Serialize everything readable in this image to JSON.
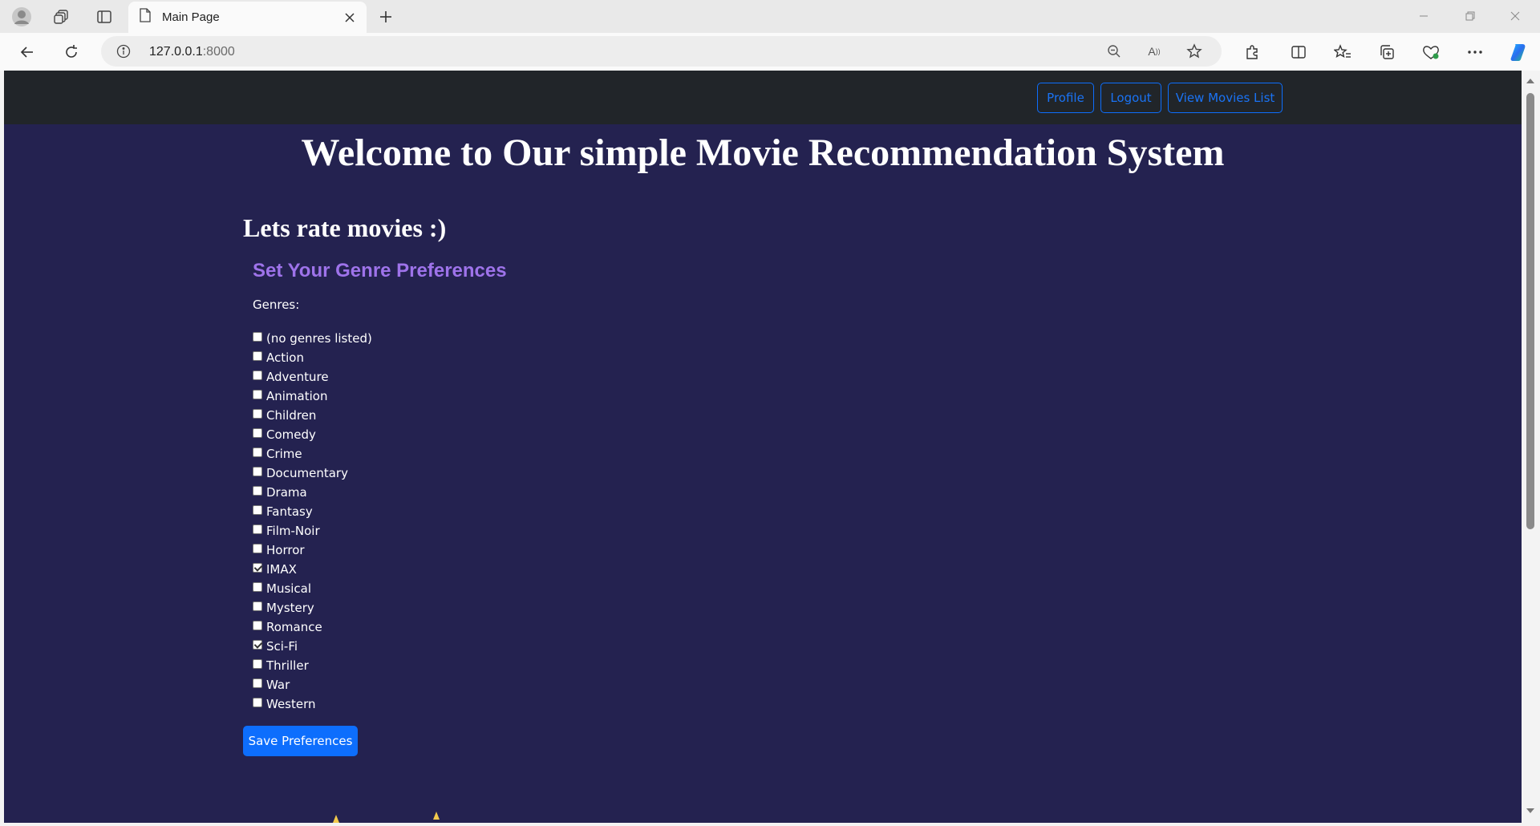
{
  "browser": {
    "tab_title": "Main Page",
    "url_host": "127.0.0.1",
    "url_port": ":8000",
    "icons": [
      "profile-icon",
      "workspaces-icon",
      "vertical-tabs-icon",
      "page-icon",
      "close-icon",
      "new-tab-icon",
      "back-icon",
      "refresh-icon",
      "site-info-icon",
      "zoom-icon",
      "read-aloud-icon",
      "favorite-star-icon",
      "extensions-icon",
      "split-screen-icon",
      "favorites-icon",
      "collections-icon",
      "browser-essentials-icon",
      "more-icon",
      "copilot-icon",
      "minimize-icon",
      "restore-icon",
      "window-close-icon"
    ]
  },
  "navbar": {
    "profile_label": "Profile",
    "logout_label": "Logout",
    "movies_label": "View Movies List",
    "accent": "#0d6efd"
  },
  "main": {
    "heading": "Welcome to Our simple Movie Recommendation System",
    "subheading": "Lets rate movies :)",
    "form_title": "Set Your Genre Preferences",
    "genres_label": "Genres:",
    "genres": [
      {
        "label": "(no genres listed)",
        "checked": false
      },
      {
        "label": "Action",
        "checked": false
      },
      {
        "label": "Adventure",
        "checked": false
      },
      {
        "label": "Animation",
        "checked": false
      },
      {
        "label": "Children",
        "checked": false
      },
      {
        "label": "Comedy",
        "checked": false
      },
      {
        "label": "Crime",
        "checked": false
      },
      {
        "label": "Documentary",
        "checked": false
      },
      {
        "label": "Drama",
        "checked": false
      },
      {
        "label": "Fantasy",
        "checked": false
      },
      {
        "label": "Film-Noir",
        "checked": false
      },
      {
        "label": "Horror",
        "checked": false
      },
      {
        "label": "IMAX",
        "checked": true
      },
      {
        "label": "Musical",
        "checked": false
      },
      {
        "label": "Mystery",
        "checked": false
      },
      {
        "label": "Romance",
        "checked": false
      },
      {
        "label": "Sci-Fi",
        "checked": true
      },
      {
        "label": "Thriller",
        "checked": false
      },
      {
        "label": "War",
        "checked": false
      },
      {
        "label": "Western",
        "checked": false
      }
    ],
    "save_label": "Save Preferences",
    "background": "#242250",
    "title_color": "#9e73ea"
  }
}
